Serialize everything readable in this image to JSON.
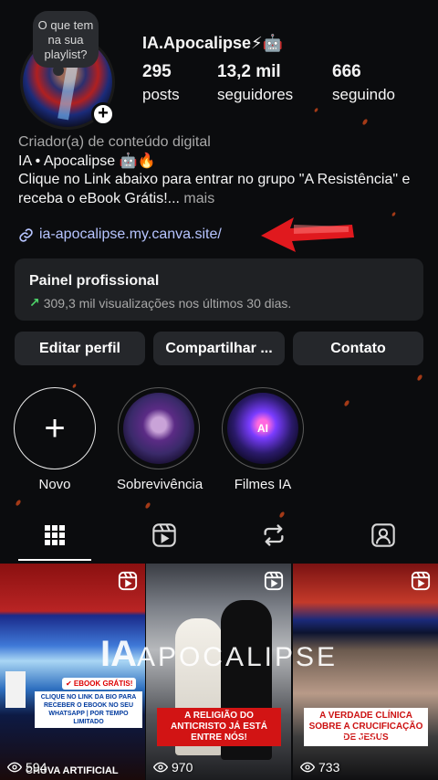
{
  "profile": {
    "note": "O que tem na sua playlist?",
    "username": "IA.Apocalipse⚡🤖",
    "stats": [
      {
        "value": "295",
        "label": "posts"
      },
      {
        "value": "13,2 mil",
        "label": "seguidores"
      },
      {
        "value": "666",
        "label": "seguindo"
      }
    ]
  },
  "bio": {
    "category": "Criador(a) de conteúdo digital",
    "line1": "IA • Apocalipse 🤖🔥",
    "line2": "Clique no Link abaixo para entrar no grupo \"A Resistência\" e",
    "line3": "receba o eBook Grátis!...",
    "more": " mais",
    "link": "ia-apocalipse.my.canva.site/"
  },
  "pro_panel": {
    "title": "Painel profissional",
    "subtitle": "309,3 mil visualizações nos últimos 30 dias."
  },
  "buttons": {
    "edit": "Editar perfil",
    "share": "Compartilhar ...",
    "contact": "Contato"
  },
  "highlights": [
    {
      "label": "Novo",
      "icon": "plus-icon"
    },
    {
      "label": "Sobrevivência"
    },
    {
      "label": "Filmes IA",
      "badge": "AI"
    }
  ],
  "tabs": [
    {
      "name": "grid-icon"
    },
    {
      "name": "reels-icon"
    },
    {
      "name": "reposts-icon"
    },
    {
      "name": "tagged-icon"
    }
  ],
  "grid": {
    "watermark_ia": "IA",
    "watermark_text": "APOCALIPSE",
    "posts": [
      {
        "views": "594",
        "caption_top": "✔ EBOOK GRÁTIS!",
        "caption_mid": "CLIQUE NO LINK DA BIO PARA RECEBER O EBOOK NO SEU WHATSAPP | POR TEMPO LIMITADO",
        "caption_bottom": "CHUVA ARTIFICIAL"
      },
      {
        "views": "970",
        "caption": "A RELIGIÃO DO ANTICRISTO JÁ ESTÁ ENTRE NÓS!"
      },
      {
        "views": "733",
        "caption": "A VERDADE CLÍNICA SOBRE A CRUCIFICAÇÃO DE JESUS",
        "watermark": "APOCALIPSE"
      }
    ]
  },
  "colors": {
    "background": "#0b0c0e",
    "link": "#b6c4ff",
    "panel": "#1f2124",
    "button": "#25272b",
    "growth": "#4ed46a",
    "arrow": "#e0191e"
  }
}
